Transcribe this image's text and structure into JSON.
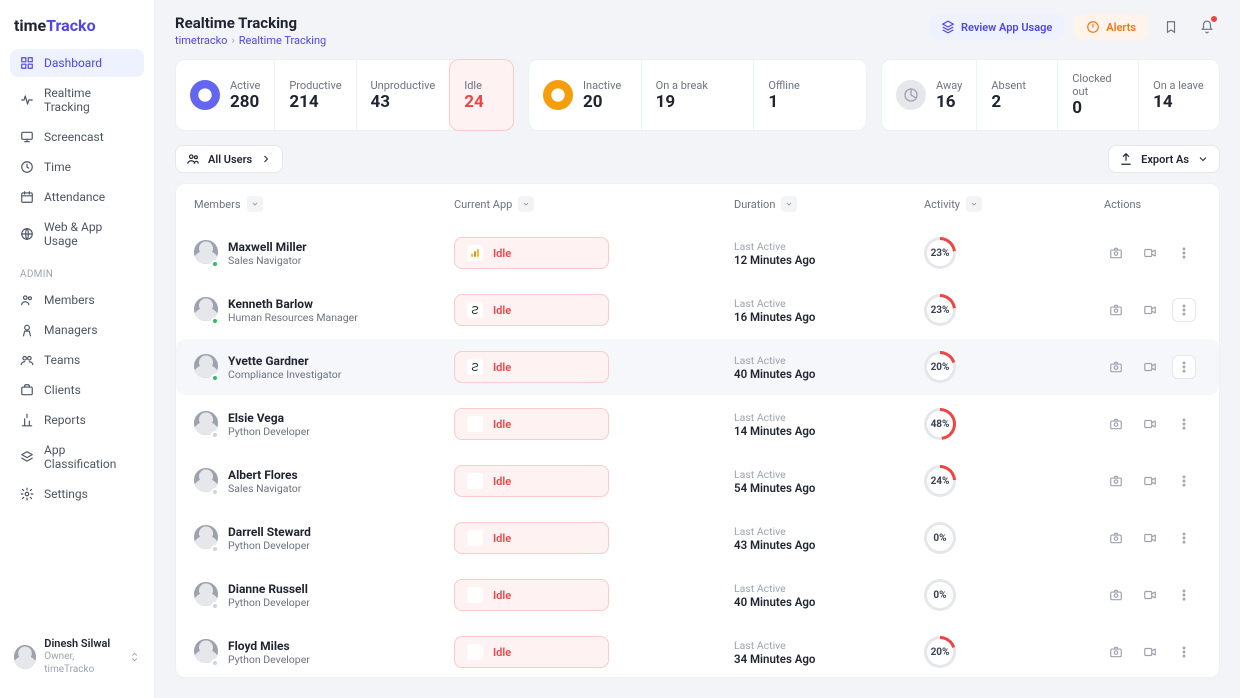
{
  "brand": {
    "pre": "time",
    "accent": "Tracko"
  },
  "sidebar": {
    "items": [
      {
        "label": "Dashboard",
        "icon": "grid"
      },
      {
        "label": "Realtime Tracking",
        "icon": "pulse"
      },
      {
        "label": "Screencast",
        "icon": "monitor"
      },
      {
        "label": "Time",
        "icon": "clock"
      },
      {
        "label": "Attendance",
        "icon": "calendar"
      },
      {
        "label": "Web & App Usage",
        "icon": "globe"
      }
    ],
    "admin_label": "ADMIN",
    "admin_items": [
      {
        "label": "Members",
        "icon": "users"
      },
      {
        "label": "Managers",
        "icon": "badge"
      },
      {
        "label": "Teams",
        "icon": "team"
      },
      {
        "label": "Clients",
        "icon": "briefcase"
      },
      {
        "label": "Reports",
        "icon": "report"
      },
      {
        "label": "App Classification",
        "icon": "layers"
      },
      {
        "label": "Settings",
        "icon": "gear"
      }
    ]
  },
  "header": {
    "title": "Realtime Tracking",
    "crumb_root": "timetracko",
    "crumb_here": "Realtime Tracking",
    "review_label": "Review App Usage",
    "alerts_label": "Alerts"
  },
  "stats": {
    "c1": [
      {
        "label": "Active",
        "val": "280",
        "icon": "check"
      },
      {
        "label": "Productive",
        "val": "214"
      },
      {
        "label": "Unproductive",
        "val": "43"
      },
      {
        "label": "Idle",
        "val": "24",
        "highlight": true
      }
    ],
    "c2": [
      {
        "label": "Inactive",
        "val": "20",
        "icon": "minus"
      },
      {
        "label": "On a break",
        "val": "19"
      },
      {
        "label": "Offline",
        "val": "1"
      }
    ],
    "c3": [
      {
        "label": "Away",
        "val": "16",
        "icon": "pie"
      },
      {
        "label": "Absent",
        "val": "2"
      },
      {
        "label": "Clocked out",
        "val": "0"
      },
      {
        "label": "On a leave",
        "val": "14"
      }
    ]
  },
  "toolbar": {
    "all_users": "All Users",
    "export": "Export As"
  },
  "columns": {
    "members": "Members",
    "app": "Current App",
    "duration": "Duration",
    "activity": "Activity",
    "actions": "Actions"
  },
  "idle_label": "Idle",
  "last_active_label": "Last Active",
  "rows": [
    {
      "name": "Maxwell Miller",
      "role": "Sales Navigator",
      "appicon": "ga",
      "dur": "12 Minutes Ago",
      "pct": 23,
      "presence": "green"
    },
    {
      "name": "Kenneth Barlow",
      "role": "Human Resources Manager",
      "appicon": "amz",
      "dur": "16 Minutes Ago",
      "pct": 23,
      "presence": "green",
      "boxed": true
    },
    {
      "name": "Yvette Gardner",
      "role": "Compliance Investigator",
      "appicon": "amz",
      "dur": "40 Minutes Ago",
      "pct": 20,
      "presence": "green",
      "hover": true,
      "boxed": true
    },
    {
      "name": "Elsie Vega",
      "role": "Python Developer",
      "appicon": "blank",
      "dur": "14 Minutes Ago",
      "pct": 48,
      "presence": "grey"
    },
    {
      "name": "Albert Flores",
      "role": "Sales Navigator",
      "appicon": "blank",
      "dur": "54 Minutes Ago",
      "pct": 24,
      "presence": "grey"
    },
    {
      "name": "Darrell Steward",
      "role": "Python Developer",
      "appicon": "blank",
      "dur": "43 Minutes Ago",
      "pct": 0,
      "presence": "grey"
    },
    {
      "name": "Dianne Russell",
      "role": "Python Developer",
      "appicon": "blank",
      "dur": "40 Minutes Ago",
      "pct": 0,
      "presence": "grey"
    },
    {
      "name": "Floyd Miles",
      "role": "Python Developer",
      "appicon": "blank",
      "dur": "34 Minutes Ago",
      "pct": 20,
      "presence": "grey"
    }
  ],
  "user": {
    "name": "Dinesh Silwal",
    "role": "Owner, timeTracko"
  }
}
